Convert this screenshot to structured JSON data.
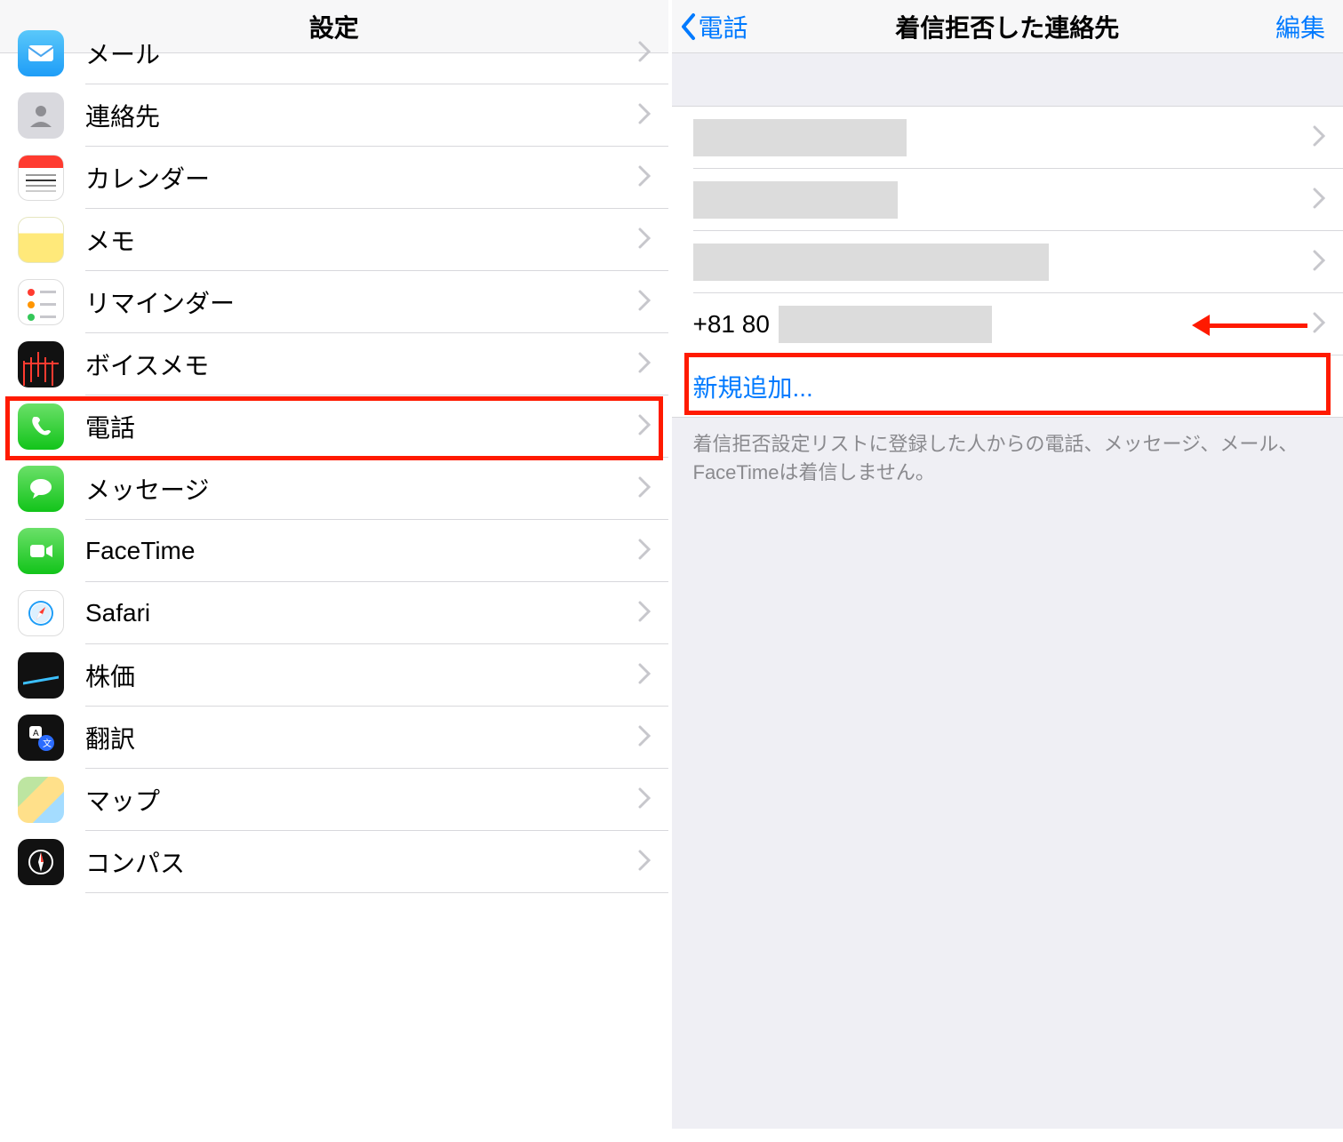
{
  "left": {
    "title": "設定",
    "items": [
      {
        "label": "メール",
        "icon": "mail-icon"
      },
      {
        "label": "連絡先",
        "icon": "contacts-icon"
      },
      {
        "label": "カレンダー",
        "icon": "calendar-icon"
      },
      {
        "label": "メモ",
        "icon": "notes-icon"
      },
      {
        "label": "リマインダー",
        "icon": "reminders-icon"
      },
      {
        "label": "ボイスメモ",
        "icon": "voice-memos-icon"
      },
      {
        "label": "電話",
        "icon": "phone-icon",
        "highlighted": true
      },
      {
        "label": "メッセージ",
        "icon": "messages-icon"
      },
      {
        "label": "FaceTime",
        "icon": "facetime-icon"
      },
      {
        "label": "Safari",
        "icon": "safari-icon"
      },
      {
        "label": "株価",
        "icon": "stocks-icon"
      },
      {
        "label": "翻訳",
        "icon": "translate-icon"
      },
      {
        "label": "マップ",
        "icon": "maps-icon"
      },
      {
        "label": "コンパス",
        "icon": "compass-icon"
      }
    ]
  },
  "right": {
    "back_label": "電話",
    "title": "着信拒否した連絡先",
    "edit_label": "編集",
    "blocked": [
      {
        "display": "",
        "masked": true
      },
      {
        "display": "",
        "masked": true
      },
      {
        "display": "",
        "masked": true
      },
      {
        "display": "+81 80",
        "masked_suffix": true,
        "arrow_annotation": true
      }
    ],
    "add_new_label": "新規追加...",
    "footer_note": "着信拒否設定リストに登録した人からの電話、メッセージ、メール、FaceTimeは着信しません。"
  },
  "colors": {
    "ios_blue": "#007aff",
    "highlight_red": "#ff1a00",
    "separator": "#d8d8dc",
    "secondary_bg": "#efeff4",
    "mask_gray": "#dcdcdc"
  }
}
